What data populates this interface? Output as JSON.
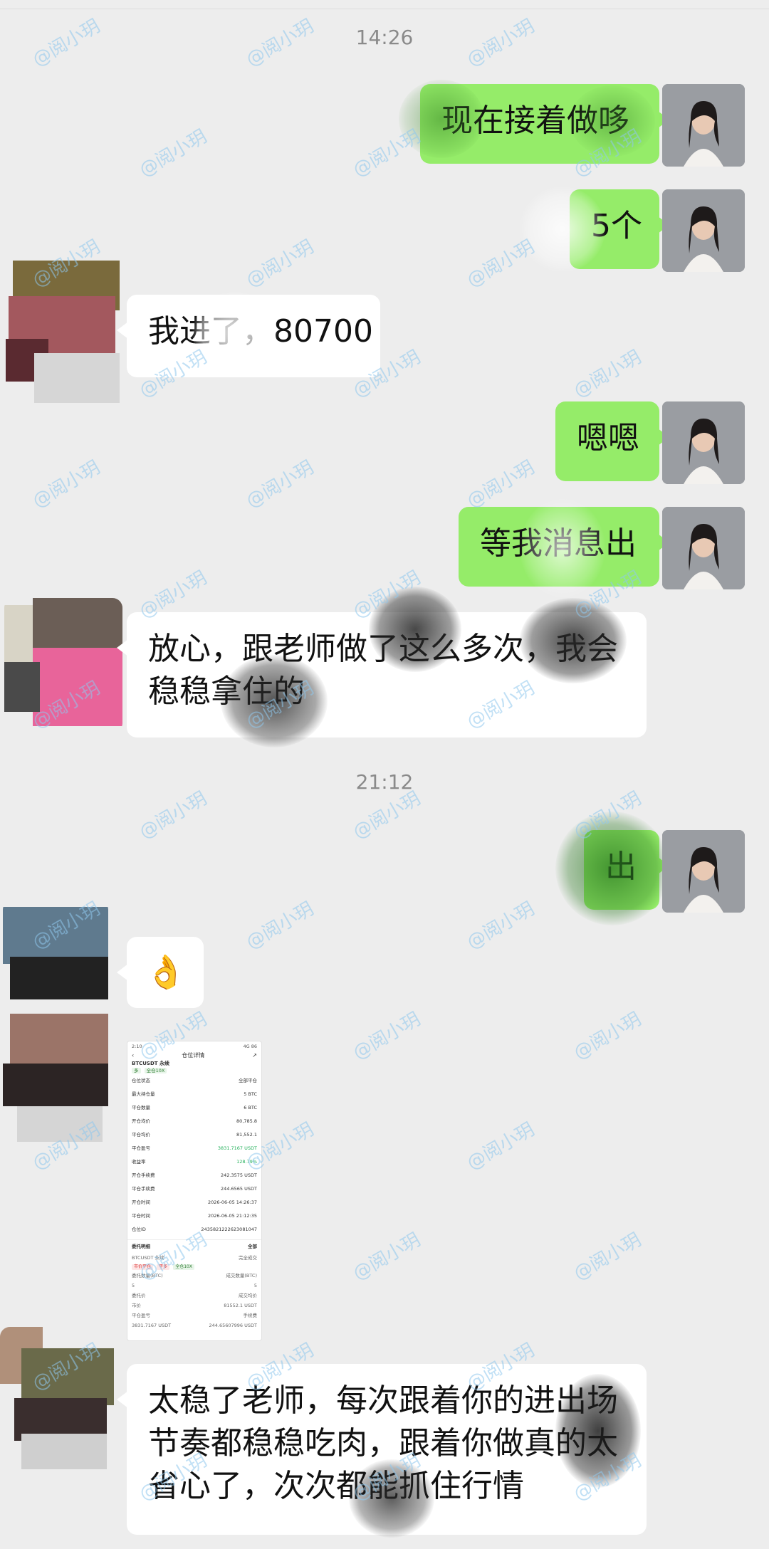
{
  "watermark": "@阅小玥",
  "messages": {
    "time_1": "14:26",
    "m1": "现在接着做哆",
    "m2": "5个",
    "m3": "我进了，80700",
    "m4": "嗯嗯",
    "m5": "等我消息出",
    "m6": "放心，跟老师做了这么多次，我会稳稳拿住的",
    "time_2": "21:12",
    "m7": "出",
    "m8_emoji": "👌",
    "m10": "太稳了老师，每次跟着你的进出场节奏都稳稳吃肉，跟着你做真的太省心了，次次都能抓住行情"
  },
  "screenshot": {
    "status_time": "2:10",
    "status_right": "4G 86",
    "title": "仓位详情",
    "pair": "BTCUSDT 永续",
    "tags": [
      "多",
      "全仓10X"
    ],
    "rows": [
      {
        "k": "仓位状态",
        "v": "全部平仓"
      },
      {
        "k": "最大持仓量",
        "v": "5 BTC"
      },
      {
        "k": "平仓数量",
        "v": "6 BTC"
      },
      {
        "k": "开仓均价",
        "v": "80,785.8"
      },
      {
        "k": "平仓均价",
        "v": "81,552.1"
      },
      {
        "k": "平仓盈亏",
        "v": "3831.7167 USDT",
        "green": true
      },
      {
        "k": "收益率",
        "v": "128.79%",
        "green": true
      },
      {
        "k": "开仓手续费",
        "v": "242.3575 USDT"
      },
      {
        "k": "平仓手续费",
        "v": "244.6565 USDT"
      },
      {
        "k": "开仓时间",
        "v": "2026-06-05 14:26:37"
      },
      {
        "k": "平仓时间",
        "v": "2026-06-05 21:12:35"
      },
      {
        "k": "仓位ID",
        "v": "2435821222623081047"
      }
    ],
    "section": "委托明细",
    "section_right": "全部",
    "order_pair": "BTCUSDT 永续",
    "order_status": "完全成交",
    "order_tags": [
      "市价平仓",
      "平多",
      "全仓10X"
    ],
    "order_rows": [
      {
        "k": "委托数量(BTC)",
        "v": "成交数量(BTC)"
      },
      {
        "k": "5",
        "v": "5"
      },
      {
        "k": "委托价",
        "v": "成交均价"
      },
      {
        "k": "市价",
        "v": "81552.1 USDT"
      },
      {
        "k": "平仓盈亏",
        "v": "手续费"
      },
      {
        "k": "3831.7167 USDT",
        "v": "244.65607996 USDT"
      }
    ]
  },
  "colors": {
    "background": "#ededed",
    "outgoing_bubble": "#95ec69",
    "incoming_bubble": "#ffffff",
    "profit_green": "#23b05a"
  }
}
